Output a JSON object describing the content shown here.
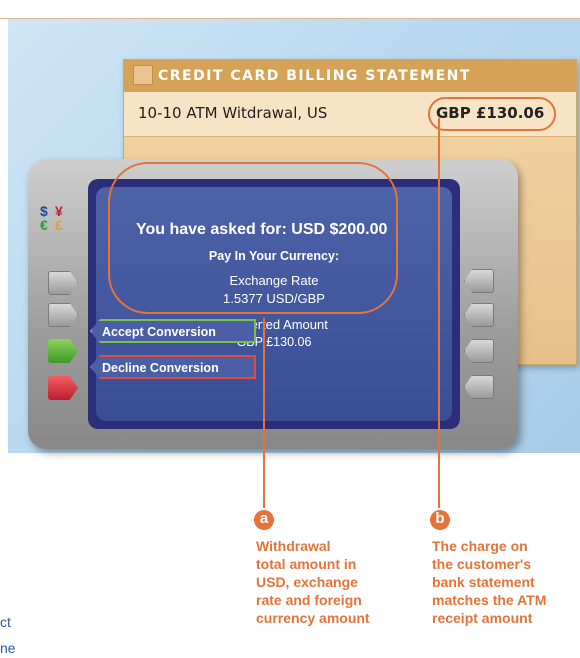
{
  "statement": {
    "title": "CREDIT CARD BILLING STATEMENT",
    "description": "10-10  ATM Witdrawal, US",
    "amount": "GBP £130.06"
  },
  "atm_screen": {
    "request": "You have asked for: USD $200.00",
    "pay_in_currency": "Pay In Your Currency:",
    "exchange_rate_label": "Exchange Rate",
    "exchange_rate_value": "1.5377  USD/GBP",
    "converted_label": "Converted Amount",
    "converted_value": "GBP £130.06",
    "accept_label": "Accept Conversion",
    "decline_label": "Decline Conversion"
  },
  "currency_symbols": [
    "$",
    "¥",
    "€",
    "£"
  ],
  "callouts": [
    {
      "badge": "a",
      "lines": [
        "Withdrawal",
        "total amount in",
        "USD, exchange",
        "rate and foreign",
        "currency amount"
      ]
    },
    {
      "badge": "b",
      "lines": [
        "The charge on",
        "the customer's",
        "bank statement",
        "matches the ATM",
        "receipt amount"
      ]
    }
  ],
  "stray_text": [
    "ct",
    "ne"
  ],
  "colors": {
    "accent": "#e4743a",
    "screen": "#3a4e98",
    "accept": "#79c247",
    "decline": "#e04b3b",
    "statement": "#d5a257",
    "background": "#b9d8ef"
  }
}
